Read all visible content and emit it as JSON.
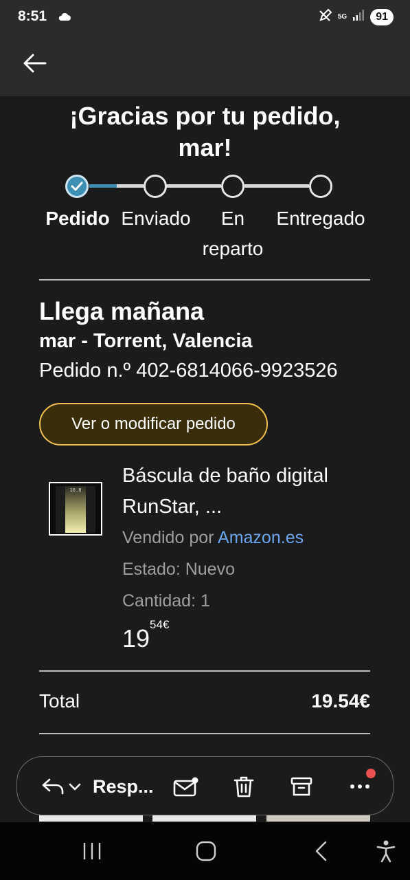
{
  "status_bar": {
    "time": "8:51",
    "network": "5G",
    "battery": "91"
  },
  "email": {
    "greeting": "¡Gracias por tu pedido, mar!",
    "progress": {
      "current_step": 1,
      "steps": [
        {
          "label": "Pedido"
        },
        {
          "label": "Enviado"
        },
        {
          "label": "En reparto"
        },
        {
          "label": "Entregado"
        }
      ]
    },
    "arrival": "Llega mañana",
    "destination": "mar - Torrent, Valencia",
    "order_number": "Pedido n.º 402-6814066-9923526",
    "view_order_button": "Ver o modificar pedido",
    "product": {
      "thumbnail_text": "16.8",
      "name": "Báscula de baño digital RunStar, ...",
      "seller_prefix": "Vendido por",
      "seller_link": "Amazon.es",
      "condition": "Estado: Nuevo",
      "quantity": "Cantidad: 1",
      "price_int": "19",
      "price_dec": "54€"
    },
    "total_label": "Total",
    "total_value": "19.54€"
  },
  "action_bar": {
    "reply_label": "Resp..."
  },
  "colors": {
    "background": "#1b1b1b",
    "bar_background": "#2b2b2b",
    "accent_yellow": "#f2c14e",
    "progress_done": "#3d8fb3",
    "link_blue": "#6aa6f0",
    "notification_red": "#e8514f"
  },
  "icons": [
    "back-arrow-icon",
    "reply-icon",
    "chevron-down-icon",
    "mark-unread-icon",
    "trash-icon",
    "archive-icon",
    "more-icon",
    "check-icon",
    "recents-icon",
    "home-icon",
    "nav-back-icon",
    "accessibility-icon"
  ]
}
